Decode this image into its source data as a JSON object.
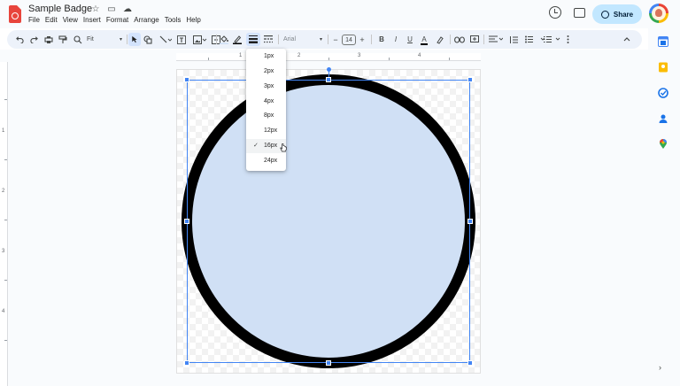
{
  "app": {
    "doc_title": "Sample Badge",
    "menu": [
      "File",
      "Edit",
      "View",
      "Insert",
      "Format",
      "Arrange",
      "Tools",
      "Help"
    ],
    "share_label": "Share",
    "star_glyph": "☆",
    "folder_glyph": "▭",
    "cloud_glyph": "☁"
  },
  "toolbar": {
    "zoom_value": "Fit",
    "font_name": "Arial",
    "font_size": "14",
    "bold": "B",
    "italic": "I",
    "underline": "U",
    "text_color": "A",
    "minus": "−",
    "plus": "+"
  },
  "border_weight_menu": {
    "options": [
      "1px",
      "2px",
      "3px",
      "4px",
      "8px",
      "12px",
      "16px",
      "24px"
    ],
    "selected": "16px",
    "check_glyph": "✓"
  },
  "ruler": {
    "top_labels": [
      "1",
      "2",
      "3",
      "4"
    ],
    "left_labels": [
      "1",
      "2",
      "3",
      "4"
    ]
  },
  "shape": {
    "fill_color": "#d0e0f5",
    "border_color": "#000000"
  },
  "colors": {
    "accent": "#4285f4",
    "share_bg": "#c2e7ff",
    "toolbar_bg": "#edf2fa"
  }
}
